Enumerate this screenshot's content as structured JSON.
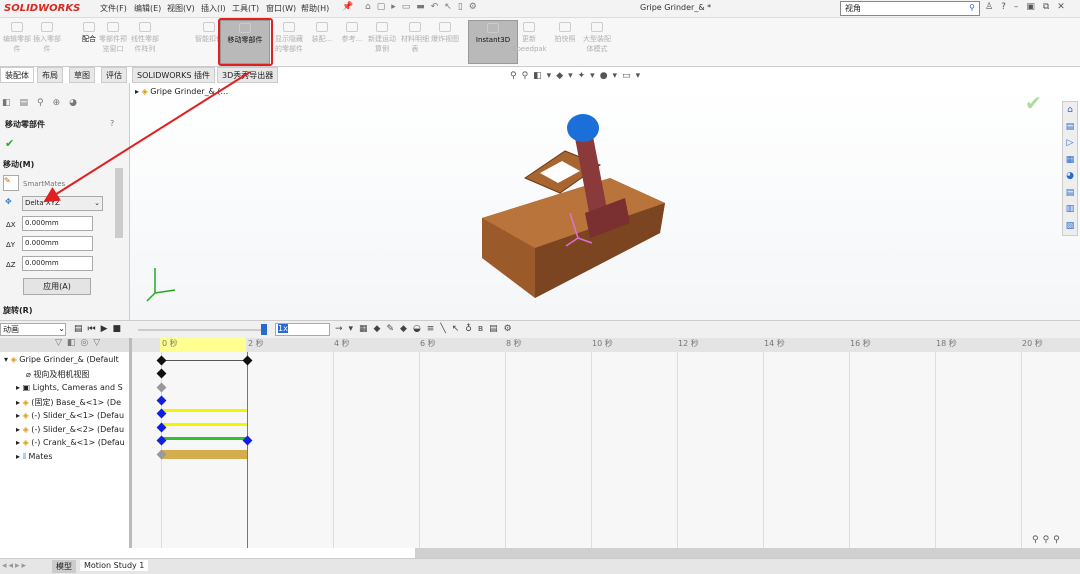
{
  "app": {
    "logo": "SOLIDWORKS",
    "title": "Gripe Grinder_& *",
    "search_placeholder": "视角"
  },
  "menu": [
    "文件(F)",
    "编辑(E)",
    "视图(V)",
    "插入(I)",
    "工具(T)",
    "窗口(W)",
    "帮助(H)"
  ],
  "ribbon": [
    {
      "label": "编辑零部件",
      "state": "disabled"
    },
    {
      "label": "插入零部件",
      "state": "disabled"
    },
    {
      "label": "配合",
      "state": "enabled"
    },
    {
      "label": "零部件预览窗口",
      "state": "disabled"
    },
    {
      "label": "线性零部件阵列",
      "state": "disabled"
    },
    {
      "label": "智能扣件",
      "state": "disabled"
    },
    {
      "label": "移动零部件",
      "state": "active"
    },
    {
      "label": "显示隐藏的零部件",
      "state": "disabled"
    },
    {
      "label": "装配...",
      "state": "disabled"
    },
    {
      "label": "参考...",
      "state": "disabled"
    },
    {
      "label": "新建运动算例",
      "state": "disabled"
    },
    {
      "label": "材料明细表",
      "state": "disabled"
    },
    {
      "label": "爆炸视图",
      "state": "disabled"
    },
    {
      "label": "Instant3D",
      "state": "active"
    },
    {
      "label": "更新Speedpak",
      "state": "disabled"
    },
    {
      "label": "拍快照",
      "state": "disabled"
    },
    {
      "label": "大型装配体模式",
      "state": "disabled"
    }
  ],
  "tabs": [
    "装配体",
    "布局",
    "草图",
    "评估",
    "SOLIDWORKS 插件",
    "3D秀秀导出器"
  ],
  "viewport": {
    "tree_root": "Gripe Grinder_&  (..."
  },
  "pm": {
    "title": "移动零部件",
    "move_label": "移动(M)",
    "smartmates": "SmartMates",
    "mode": "Delta XYZ",
    "dx_label": "ΔX",
    "dy_label": "ΔY",
    "dz_label": "ΔZ",
    "dx": "0.000mm",
    "dy": "0.000mm",
    "dz": "0.000mm",
    "apply": "应用(A)",
    "rotate_label": "旋转(R)"
  },
  "motion": {
    "study_type": "动画",
    "speed": "1x",
    "tree": [
      "Gripe Grinder_&  (Default",
      "视向及相机视图",
      "Lights, Cameras and S",
      "(固定) Base_&<1> (De",
      "(-) Slider_&<1> (Defau",
      "(-) Slider_&<2> (Defau",
      "(-) Crank_&<1> (Defau",
      "Mates"
    ],
    "ticks": [
      "0 秒",
      "2 秒",
      "4 秒",
      "6 秒",
      "8 秒",
      "10 秒",
      "12 秒",
      "14 秒",
      "16 秒",
      "18 秒",
      "20 秒"
    ],
    "duration_sec": 2
  },
  "bottom_tabs": [
    "模型",
    "Motion Study 1"
  ],
  "colors": {
    "highlight": "#e02020",
    "yellow": "#f5f500",
    "green": "#30c030",
    "gold": "#d4ad4c",
    "key": "#1020e0"
  }
}
